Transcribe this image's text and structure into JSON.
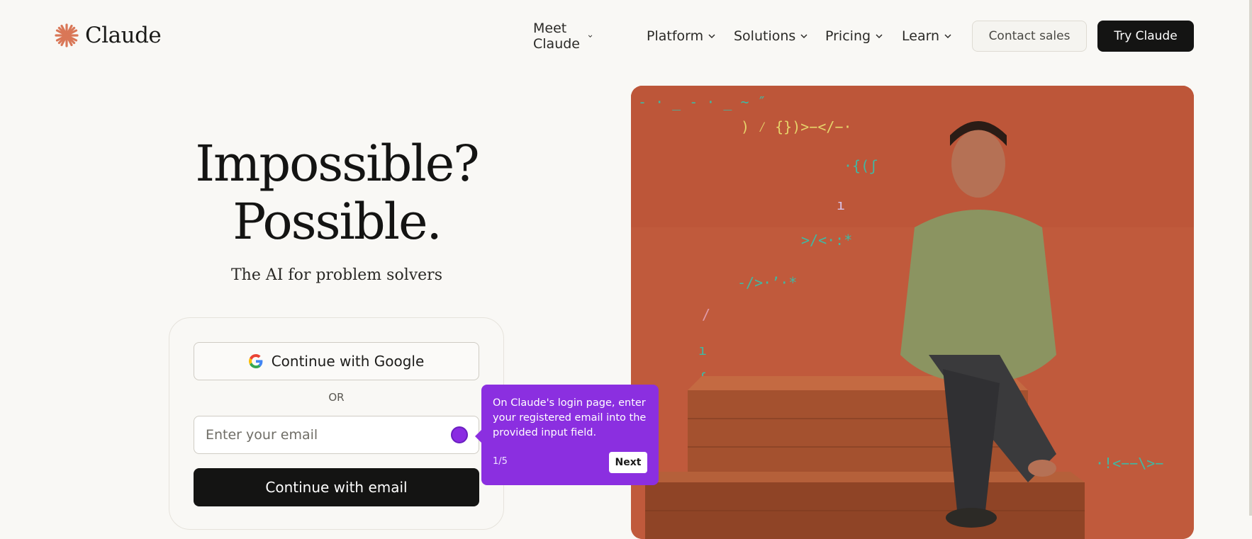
{
  "brand": {
    "name": "Claude",
    "accent": "#d97757",
    "logo_icon": "claude-asterisk-icon"
  },
  "nav": {
    "items": [
      {
        "label": "Meet Claude",
        "icon": "chevron-down-icon"
      },
      {
        "label": "Platform",
        "icon": "chevron-down-icon"
      },
      {
        "label": "Solutions",
        "icon": "chevron-down-icon"
      },
      {
        "label": "Pricing",
        "icon": "chevron-down-icon"
      },
      {
        "label": "Learn",
        "icon": "chevron-down-icon"
      }
    ],
    "contact_label": "Contact sales",
    "try_label": "Try Claude"
  },
  "hero": {
    "headline_line1": "Impossible?",
    "headline_line2": "Possible.",
    "subtitle": "The AI for problem solvers"
  },
  "auth": {
    "google_label": "Continue with Google",
    "google_icon": "google-g-icon",
    "or_label": "OR",
    "email_placeholder": "Enter your email",
    "email_value": "",
    "email_button_label": "Continue with email"
  },
  "tour": {
    "message": "On Claude's login page, enter your registered email into the provided input field.",
    "step": "1/5",
    "next_label": "Next",
    "color": "#8b2fe0"
  },
  "colors": {
    "background": "#f9f8f5",
    "dark_button": "#141413",
    "hero_bg": "#c0583b"
  }
}
